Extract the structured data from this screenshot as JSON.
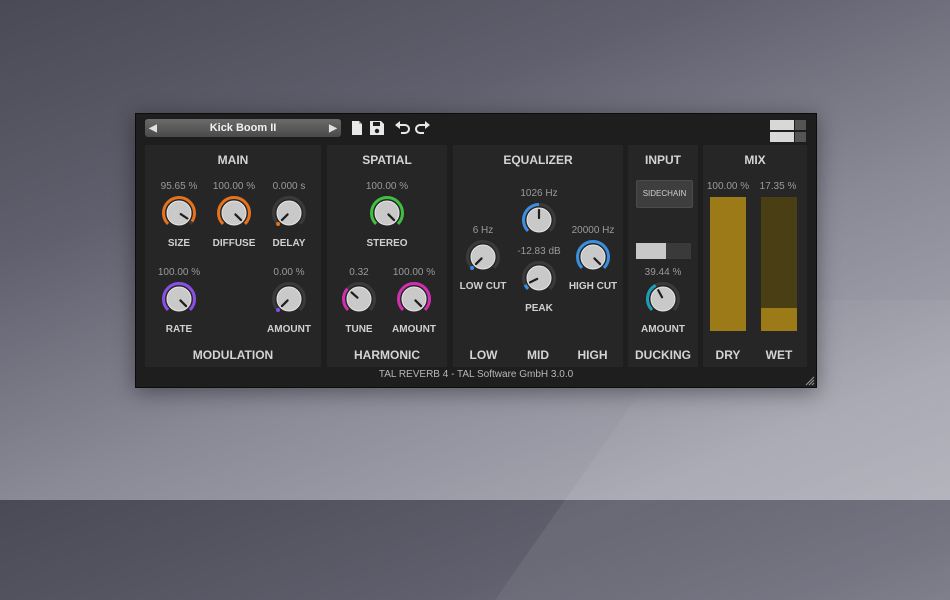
{
  "preset": {
    "name": "Kick Boom II",
    "prev_icon": "◀",
    "next_icon": "▶"
  },
  "toolbar": {
    "icons": [
      "new-file-icon",
      "save-icon",
      "undo-icon",
      "redo-icon",
      "window-size-icon"
    ]
  },
  "main": {
    "title": "MAIN",
    "size": {
      "label": "SIZE",
      "value": "95.65 %",
      "level": 0.9565,
      "color": "#e8711c"
    },
    "diffuse": {
      "label": "DIFFUSE",
      "value": "100.00 %",
      "level": 1.0,
      "color": "#e8711c"
    },
    "delay": {
      "label": "DELAY",
      "value": "0.000 s",
      "level": 0.0,
      "color": "#e8711c"
    }
  },
  "modulation": {
    "title": "MODULATION",
    "rate": {
      "label": "RATE",
      "value": "100.00 %",
      "level": 1.0,
      "color": "#8a4fe8"
    },
    "amount": {
      "label": "AMOUNT",
      "value": "0.00 %",
      "level": 0.0,
      "color": "#8a4fe8"
    }
  },
  "spatial": {
    "title": "SPATIAL",
    "stereo": {
      "label": "STEREO",
      "value": "100.00 %",
      "level": 1.0,
      "color": "#3fbf3f"
    }
  },
  "harmonic": {
    "title": "HARMONIC",
    "tune": {
      "label": "TUNE",
      "value": "0.32",
      "level": 0.32,
      "color": "#d12fb0"
    },
    "amount": {
      "label": "AMOUNT",
      "value": "100.00 %",
      "level": 1.0,
      "color": "#d12fb0"
    }
  },
  "equalizer": {
    "title": "EQUALIZER",
    "low_cut": {
      "label": "LOW CUT",
      "value": "6 Hz",
      "level": 0.0,
      "color": "#3a8fe0"
    },
    "mid_freq": {
      "label": "",
      "value": "1026 Hz",
      "level": 0.5,
      "color": "#3a8fe0"
    },
    "peak": {
      "label": "PEAK",
      "value": "-12.83 dB",
      "level": 0.07,
      "color": "#3a8fe0"
    },
    "high_cut": {
      "label": "HIGH CUT",
      "value": "20000 Hz",
      "level": 1.0,
      "color": "#3a8fe0"
    },
    "bands": {
      "low": "LOW",
      "mid": "MID",
      "high": "HIGH"
    }
  },
  "input": {
    "title": "INPUT",
    "sidechain_label": "SIDECHAIN",
    "toggle_level": 0.55
  },
  "ducking": {
    "title": "DUCKING",
    "amount": {
      "label": "AMOUNT",
      "value": "39.44 %",
      "level": 0.3944,
      "color": "#1e9fb5"
    }
  },
  "mix": {
    "title": "MIX",
    "dry": {
      "label": "DRY",
      "value": "100.00 %",
      "level": 1.0
    },
    "wet": {
      "label": "WET",
      "value": "17.35 %",
      "level": 0.1735
    },
    "meter_color": "#9c7a17"
  },
  "footer": {
    "text": "TAL REVERB 4 - TAL Software GmbH 3.0.0"
  }
}
